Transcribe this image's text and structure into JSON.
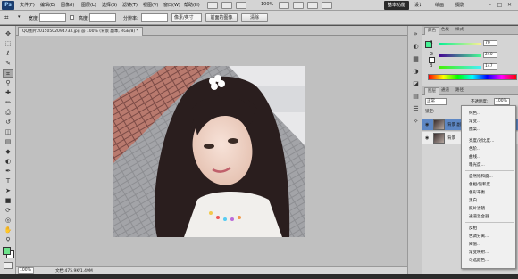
{
  "menubar": {
    "logo": "Ps",
    "items": [
      "文件(F)",
      "编辑(E)",
      "图像(I)",
      "图层(L)",
      "选择(S)",
      "滤镜(T)",
      "视图(V)",
      "窗口(W)",
      "帮助(H)"
    ],
    "zoom": "100%",
    "workspace_label": "基本功能",
    "workspace_items": [
      "设计",
      "绘画",
      "摄影"
    ]
  },
  "options": {
    "width_label": "宽度:",
    "height_label": "高度:",
    "resolution_label": "分辨率:",
    "unit_value": "像素/英寸",
    "front_image_btn": "前面的图像",
    "clear_btn": "清除"
  },
  "document": {
    "tab_title": "QQ图片20150502094733.jpg @ 100% (背景 副本, RGB/8) *",
    "zoom": "100%",
    "doc_info": "文档:475.9K/1.49M"
  },
  "color_panel": {
    "tabs": [
      "颜色",
      "色板",
      "样式"
    ],
    "r": "70",
    "g": "240",
    "b": "147",
    "fg_color": "#46f093"
  },
  "layers_panel": {
    "tabs": [
      "图层",
      "通道",
      "路径"
    ],
    "blend_mode": "正常",
    "opacity_label": "不透明度:",
    "opacity_value": "100%",
    "lock_label": "锁定:",
    "layers": [
      {
        "name": "背景 副本",
        "selected": true
      },
      {
        "name": "背景",
        "selected": false
      }
    ]
  },
  "adjust_menu": {
    "groups": [
      [
        "纯色...",
        "渐变...",
        "图案..."
      ],
      [
        "亮度/对比度...",
        "色阶...",
        "曲线...",
        "曝光度..."
      ],
      [
        "自然饱和度...",
        "色相/饱和度...",
        "色彩平衡...",
        "黑白...",
        "照片滤镜...",
        "通道混合器..."
      ],
      [
        "反相",
        "色调分离...",
        "阈值...",
        "渐变映射...",
        "可选颜色..."
      ]
    ]
  }
}
